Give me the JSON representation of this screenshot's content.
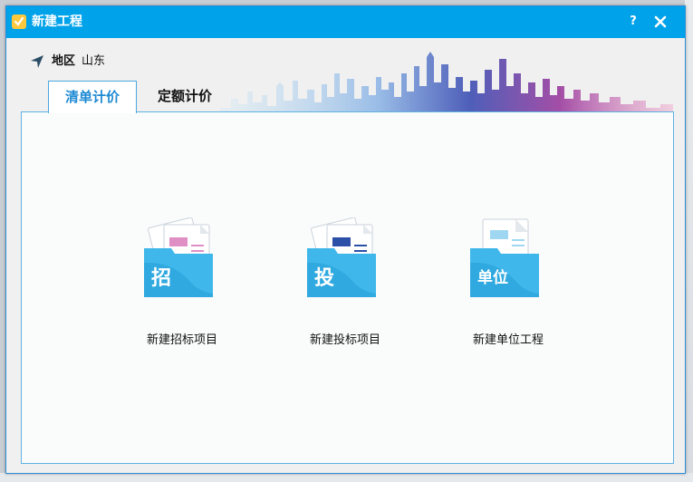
{
  "window": {
    "title": "新建工程",
    "help_label": "?",
    "close_icon": "close-icon"
  },
  "region": {
    "label": "地区",
    "value": "山东"
  },
  "tabs": [
    {
      "label": "清单计价",
      "active": true
    },
    {
      "label": "定额计价",
      "active": false
    }
  ],
  "tiles": [
    {
      "label": "新建招标项目",
      "badge": "招",
      "icon": "folder-document-icon"
    },
    {
      "label": "新建投标项目",
      "badge": "投",
      "icon": "folder-document-icon"
    },
    {
      "label": "新建单位工程",
      "badge": "单位",
      "icon": "folder-document-icon"
    }
  ],
  "colors": {
    "titlebar": "#00a2ea",
    "accent": "#1f8ad3",
    "folder": "#3fb7ea"
  }
}
